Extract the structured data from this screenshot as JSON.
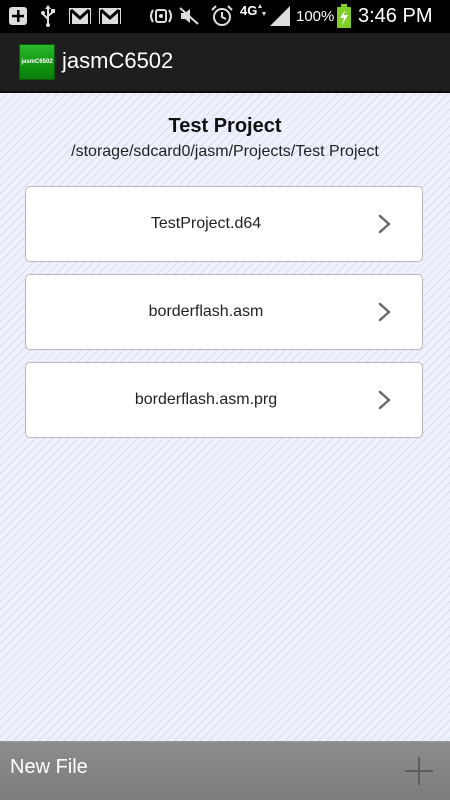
{
  "status_bar": {
    "network_type": "4G",
    "battery_percent": "100%",
    "time": "3:46 PM",
    "icons": [
      "add-notification-icon",
      "usb-icon",
      "gmail-icon",
      "gmail-icon",
      "nfc-icon",
      "mute-icon",
      "alarm-icon",
      "4g-lte-icon",
      "signal-icon",
      "battery-charging-icon"
    ]
  },
  "app_bar": {
    "logo_text": "jasmC6502",
    "title": "jasmC6502"
  },
  "project": {
    "title": "Test Project",
    "path": "/storage/sdcard0/jasm/Projects/Test Project"
  },
  "files": [
    {
      "name": "TestProject.d64"
    },
    {
      "name": "borderflash.asm"
    },
    {
      "name": "borderflash.asm.prg"
    }
  ],
  "bottom_bar": {
    "label": "New File",
    "action_icon": "plus-icon"
  },
  "colors": {
    "content_background": "#eef1fb",
    "stripe": "#d7ddf3",
    "logo_green": "#129712",
    "bottom_bar": "#858585"
  }
}
